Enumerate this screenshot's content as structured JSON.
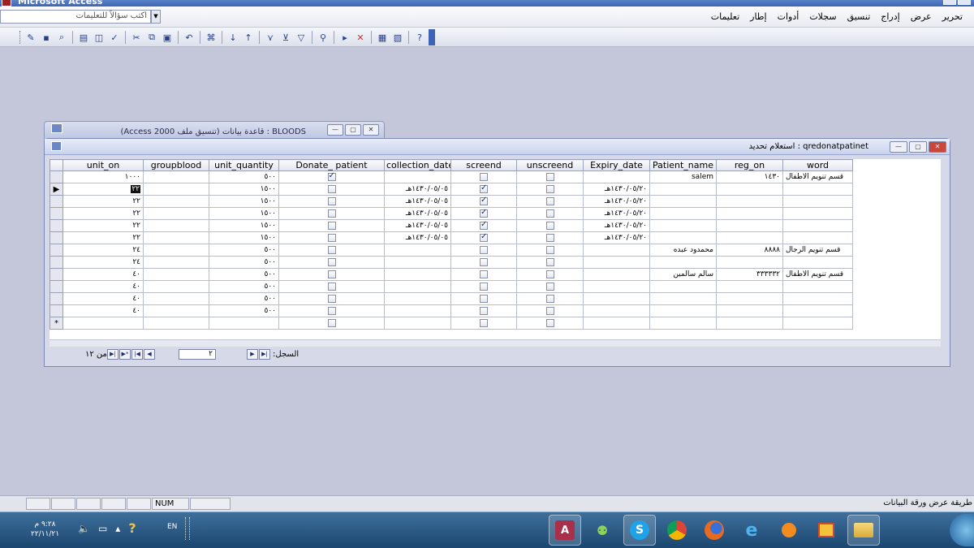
{
  "window": {
    "title": "Microsoft Access"
  },
  "menu": {
    "items": [
      "تحرير",
      "عرض",
      "إدراج",
      "تنسيق",
      "سجلات",
      "أدوات",
      "إطار",
      "تعليمات"
    ],
    "ask_placeholder": "اكتب سؤالاً للتعليمات"
  },
  "toolbar": {
    "icons": [
      "view-icon",
      "save-icon",
      "search-icon",
      "print-icon",
      "print-preview-icon",
      "spelling-icon",
      "cut-icon",
      "copy-icon",
      "paste-icon",
      "undo-icon",
      "hyperlink-icon",
      "sort-ascending-icon",
      "sort-descending-icon",
      "filter-selection-icon",
      "filter-form-icon",
      "apply-filter-icon",
      "find-icon",
      "new-record-icon",
      "delete-record-icon",
      "database-window-icon",
      "new-object-icon",
      "help-icon"
    ]
  },
  "background_window": {
    "title": "BLOODS : قاعدة بيانات (تنسيق ملف Access 2000)"
  },
  "query_window": {
    "title": "qredonatpatinet : استعلام تحديد",
    "columns": [
      "unit_on",
      "groupblood",
      "unit_quantity",
      "Donate_ patient",
      "collection_date",
      "screend",
      "unscreend",
      "Expiry_date",
      "Patient_name",
      "reg_on",
      "word"
    ],
    "rows": [
      {
        "selector": "",
        "unit_on": "١٠٠٠",
        "groupblood": "",
        "unit_quantity": "٥٠٠",
        "donate": true,
        "collection_date": "",
        "screend": false,
        "unscreend": false,
        "expiry_date": "",
        "patient_name": "salem",
        "reg_on": "١٤٣٠",
        "word": "قسم تنويم الاطفال"
      },
      {
        "selector": "▶",
        "unit_on": "٢٢",
        "groupblood": "",
        "unit_quantity": "١٥٠٠",
        "donate": false,
        "collection_date": "١٤٣٠/٠٥/٠٥هـ",
        "screend": true,
        "unscreend": false,
        "expiry_date": "١٤٣٠/٠٥/٢٠هـ",
        "patient_name": "",
        "reg_on": "",
        "word": ""
      },
      {
        "selector": "",
        "unit_on": "٢٢",
        "groupblood": "",
        "unit_quantity": "١٥٠٠",
        "donate": false,
        "collection_date": "١٤٣٠/٠٥/٠٥هـ",
        "screend": true,
        "unscreend": false,
        "expiry_date": "١٤٣٠/٠٥/٢٠هـ",
        "patient_name": "",
        "reg_on": "",
        "word": ""
      },
      {
        "selector": "",
        "unit_on": "٢٢",
        "groupblood": "",
        "unit_quantity": "١٥٠٠",
        "donate": false,
        "collection_date": "١٤٣٠/٠٥/٠٥هـ",
        "screend": true,
        "unscreend": false,
        "expiry_date": "١٤٣٠/٠٥/٢٠هـ",
        "patient_name": "",
        "reg_on": "",
        "word": ""
      },
      {
        "selector": "",
        "unit_on": "٢٢",
        "groupblood": "",
        "unit_quantity": "١٥٠٠",
        "donate": false,
        "collection_date": "١٤٣٠/٠٥/٠٥هـ",
        "screend": true,
        "unscreend": false,
        "expiry_date": "١٤٣٠/٠٥/٢٠هـ",
        "patient_name": "",
        "reg_on": "",
        "word": ""
      },
      {
        "selector": "",
        "unit_on": "٢٢",
        "groupblood": "",
        "unit_quantity": "١٥٠٠",
        "donate": false,
        "collection_date": "١٤٣٠/٠٥/٠٥هـ",
        "screend": true,
        "unscreend": false,
        "expiry_date": "١٤٣٠/٠٥/٢٠هـ",
        "patient_name": "",
        "reg_on": "",
        "word": ""
      },
      {
        "selector": "",
        "unit_on": "٢٤",
        "groupblood": "",
        "unit_quantity": "٥٠٠",
        "donate": false,
        "collection_date": "",
        "screend": false,
        "unscreend": false,
        "expiry_date": "",
        "patient_name": "محمدود عبده",
        "reg_on": "٨٨٨٨",
        "word": "قسم تنويم الرجال"
      },
      {
        "selector": "",
        "unit_on": "٢٤",
        "groupblood": "",
        "unit_quantity": "٥٠٠",
        "donate": false,
        "collection_date": "",
        "screend": false,
        "unscreend": false,
        "expiry_date": "",
        "patient_name": "",
        "reg_on": "",
        "word": ""
      },
      {
        "selector": "",
        "unit_on": "٤٠",
        "groupblood": "",
        "unit_quantity": "٥٠٠",
        "donate": false,
        "collection_date": "",
        "screend": false,
        "unscreend": false,
        "expiry_date": "",
        "patient_name": "سالم سالمين",
        "reg_on": "٣٣٣٣٣٢",
        "word": "قسم تنويم الاطفال"
      },
      {
        "selector": "",
        "unit_on": "٤٠",
        "groupblood": "",
        "unit_quantity": "٥٠٠",
        "donate": false,
        "collection_date": "",
        "screend": false,
        "unscreend": false,
        "expiry_date": "",
        "patient_name": "",
        "reg_on": "",
        "word": ""
      },
      {
        "selector": "",
        "unit_on": "٤٠",
        "groupblood": "",
        "unit_quantity": "٥٠٠",
        "donate": false,
        "collection_date": "",
        "screend": false,
        "unscreend": false,
        "expiry_date": "",
        "patient_name": "",
        "reg_on": "",
        "word": ""
      },
      {
        "selector": "",
        "unit_on": "٤٠",
        "groupblood": "",
        "unit_quantity": "٥٠٠",
        "donate": false,
        "collection_date": "",
        "screend": false,
        "unscreend": false,
        "expiry_date": "",
        "patient_name": "",
        "reg_on": "",
        "word": ""
      },
      {
        "selector": "*",
        "unit_on": "",
        "groupblood": "",
        "unit_quantity": "",
        "donate": false,
        "collection_date": "",
        "screend": false,
        "unscreend": false,
        "expiry_date": "",
        "patient_name": "",
        "reg_on": "",
        "word": ""
      }
    ],
    "nav": {
      "record_label": "السجل:",
      "current_record": "٢",
      "of_label": "من ١٢"
    }
  },
  "statusbar": {
    "num_indicator": "NUM",
    "text": "طريقة عرض ورقة البيانات"
  },
  "taskbar": {
    "time": "٩:٢٨ م",
    "date": "٢٢/١١/٢١",
    "language": "EN",
    "apps": [
      "access-app-icon",
      "people-app-icon",
      "skype-app-icon",
      "chrome-app-icon",
      "firefox-app-icon",
      "ie-app-icon",
      "media-app-icon",
      "paint-app-icon",
      "explorer-app-icon"
    ]
  },
  "colors": {
    "workspace": "#c4c6d9",
    "taskbar": "#1b4770",
    "checkbox_check": "#1c2a7a"
  }
}
